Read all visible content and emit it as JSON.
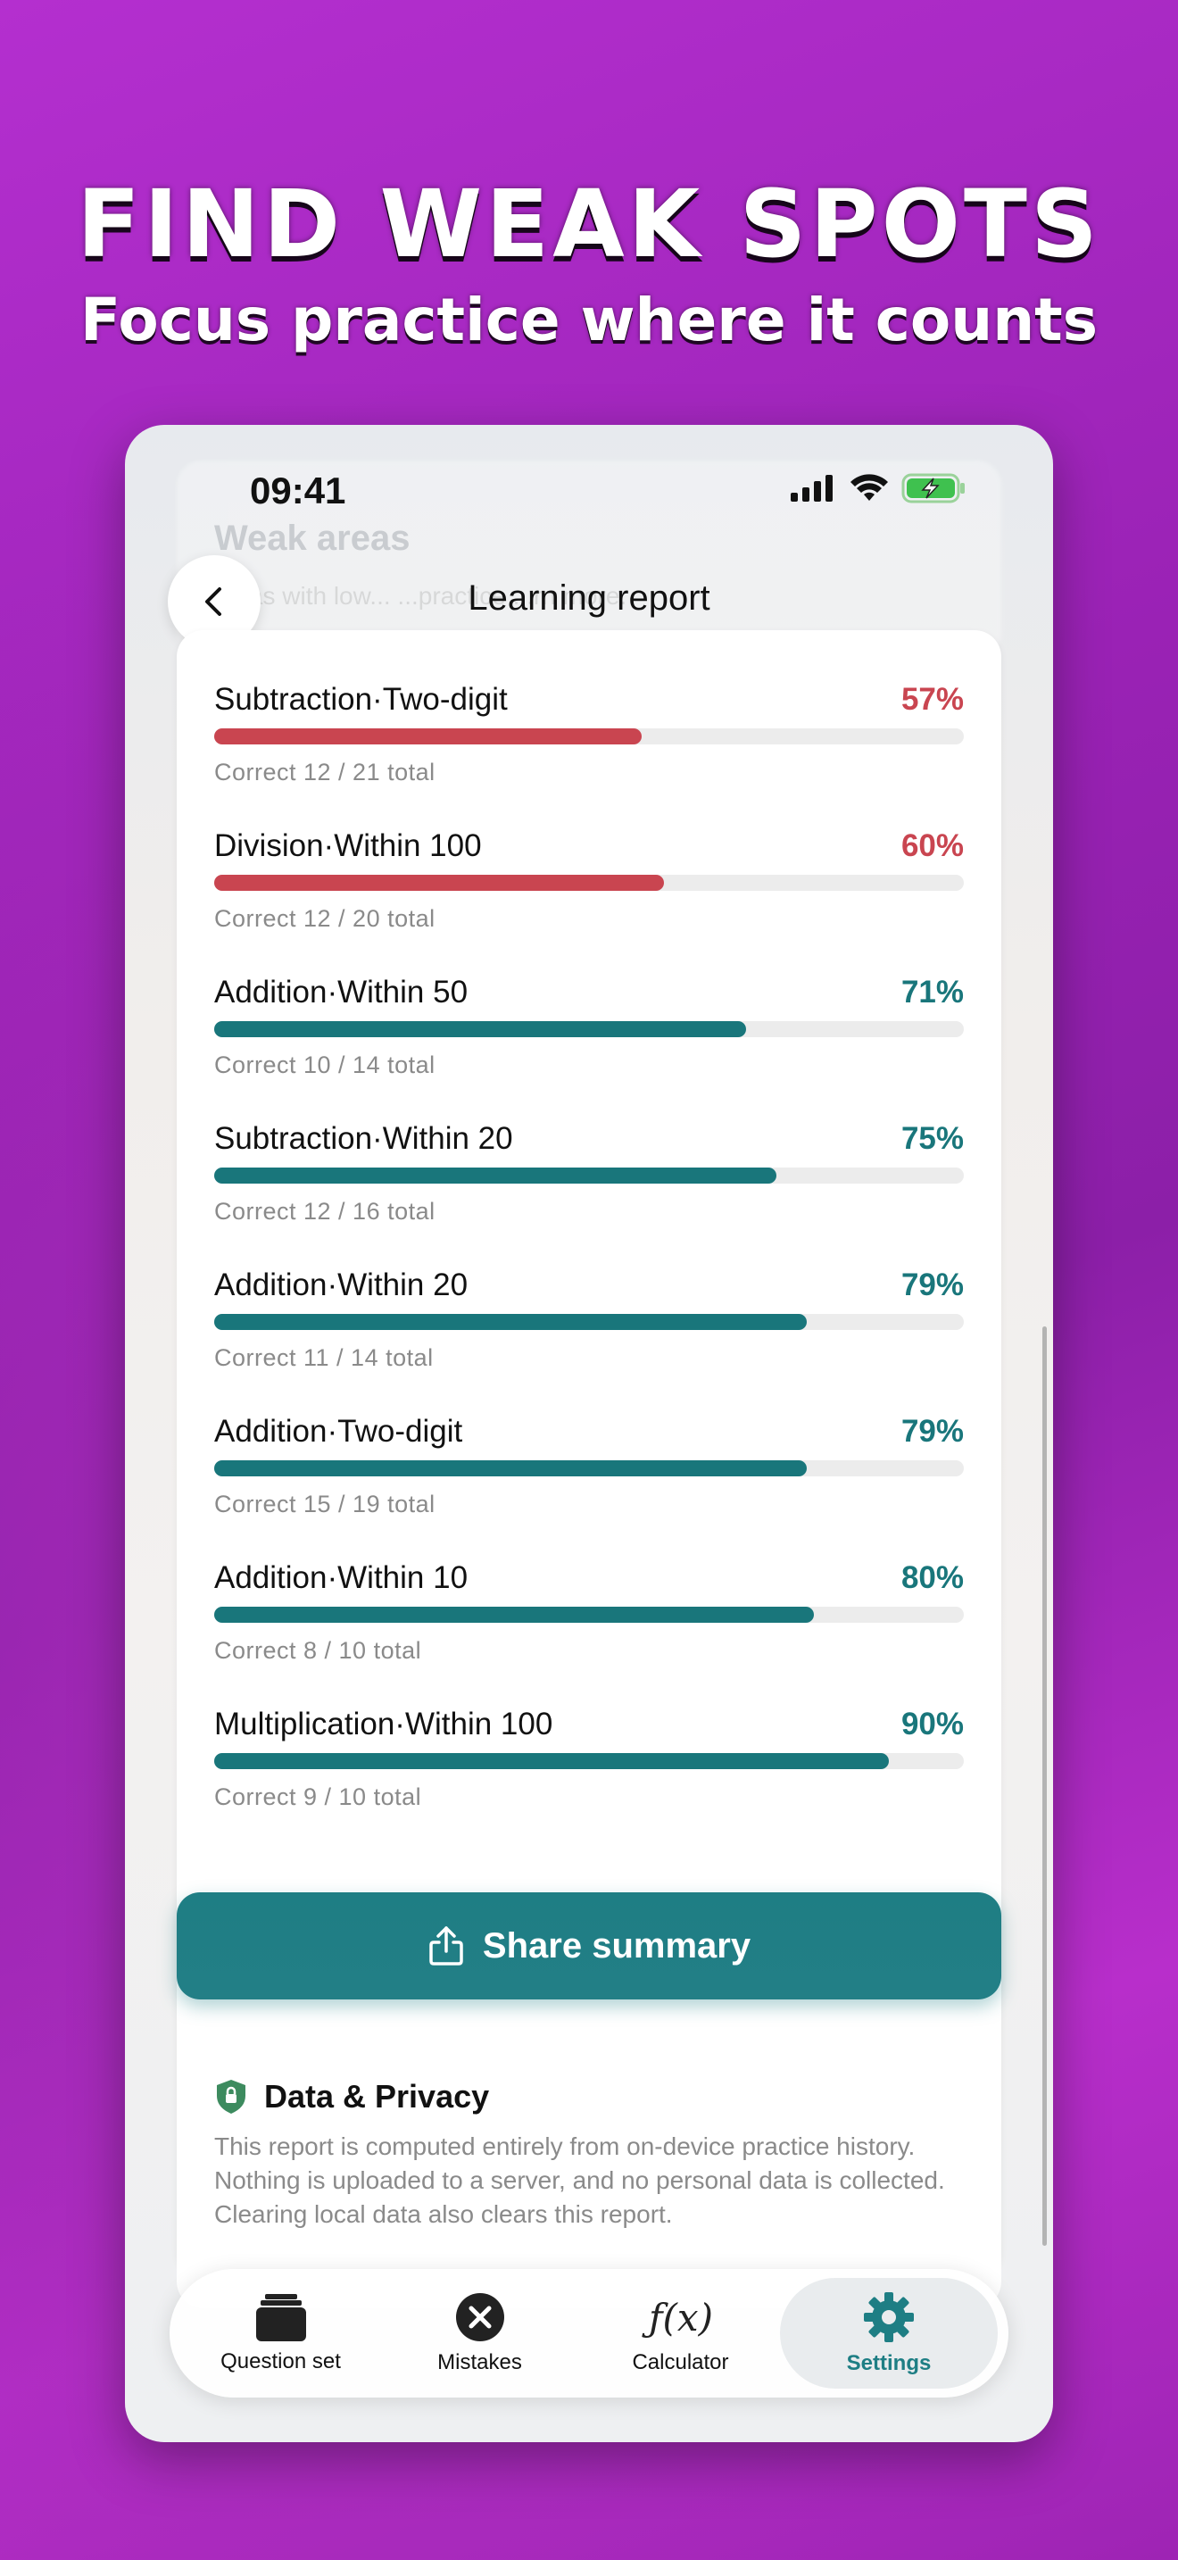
{
  "promo": {
    "headline": "FIND WEAK SPOTS",
    "subheadline": "Focus practice where it counts"
  },
  "status_bar": {
    "time": "09:41",
    "icons": [
      "signal-icon",
      "wifi-icon",
      "battery-charging-icon"
    ]
  },
  "nav": {
    "title": "Learning report",
    "back_icon": "chevron-left-icon"
  },
  "background_section": {
    "title": "Weak areas",
    "subtitle": "...eas with low... ...practice ...rn more."
  },
  "stats": [
    {
      "label": "Subtraction·Two-digit",
      "percent_text": "57%",
      "percent": 57,
      "detail": "Correct 12 / 21 total",
      "level": "weak"
    },
    {
      "label": "Division·Within 100",
      "percent_text": "60%",
      "percent": 60,
      "detail": "Correct 12 / 20 total",
      "level": "weak"
    },
    {
      "label": "Addition·Within 50",
      "percent_text": "71%",
      "percent": 71,
      "detail": "Correct 10 / 14 total",
      "level": "ok"
    },
    {
      "label": "Subtraction·Within 20",
      "percent_text": "75%",
      "percent": 75,
      "detail": "Correct 12 / 16 total",
      "level": "ok"
    },
    {
      "label": "Addition·Within 20",
      "percent_text": "79%",
      "percent": 79,
      "detail": "Correct 11 / 14 total",
      "level": "ok"
    },
    {
      "label": "Addition·Two-digit",
      "percent_text": "79%",
      "percent": 79,
      "detail": "Correct 15 / 19 total",
      "level": "ok"
    },
    {
      "label": "Addition·Within 10",
      "percent_text": "80%",
      "percent": 80,
      "detail": "Correct 8 / 10 total",
      "level": "ok"
    },
    {
      "label": "Multiplication·Within 100",
      "percent_text": "90%",
      "percent": 90,
      "detail": "Correct 9 / 10 total",
      "level": "ok"
    }
  ],
  "colors": {
    "weak": "#c94550",
    "ok": "#19767b",
    "accent": "#1e7e84"
  },
  "share": {
    "label": "Share summary",
    "icon": "share-icon"
  },
  "privacy": {
    "title": "Data & Privacy",
    "icon": "shield-lock-icon",
    "text": "This report is computed entirely from on-device practice history. Nothing is uploaded to a server, and no personal data is collected. Clearing local data also clears this report."
  },
  "tabs": [
    {
      "label": "Question set",
      "icon": "stack-icon",
      "active": false
    },
    {
      "label": "Mistakes",
      "icon": "x-circle-icon",
      "active": false
    },
    {
      "label": "Calculator",
      "icon": "function-icon",
      "active": false
    },
    {
      "label": "Settings",
      "icon": "gear-icon",
      "active": true
    }
  ]
}
